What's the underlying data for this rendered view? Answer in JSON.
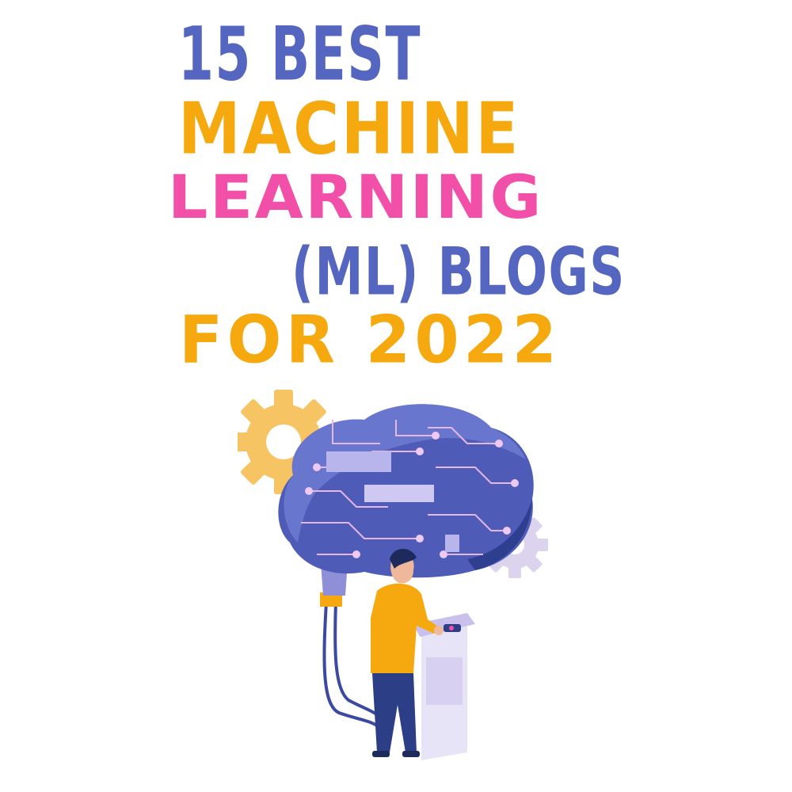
{
  "title": {
    "line1": "15 BEST",
    "line2": "MACHINE",
    "line3": "LEARNING",
    "line4": "(ML) BLOGS",
    "line5": "FOR 2022"
  },
  "colors": {
    "blue": "#5566c0",
    "orange": "#f6a90f",
    "pink": "#f24fa8",
    "brain": "#4e5cb7",
    "brain_dark": "#2f3f8f",
    "gear_orange": "#f7c464",
    "gear_lilac": "#dcd3ee",
    "shirt": "#f6a90f",
    "pants": "#2c3e86"
  }
}
